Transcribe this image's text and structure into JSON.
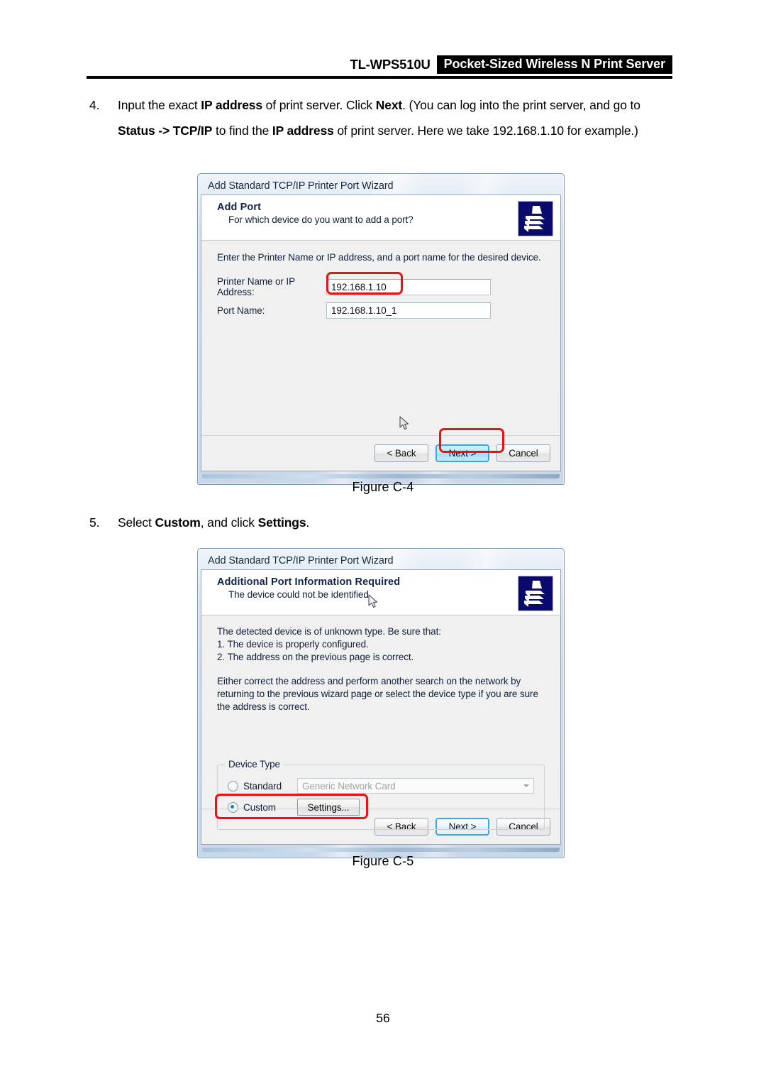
{
  "header": {
    "model": "TL-WPS510U",
    "tagline": "Pocket-Sized Wireless N Print Server"
  },
  "steps": [
    {
      "number": "4.",
      "parts": [
        {
          "text": "Input the exact ",
          "bold": false
        },
        {
          "text": "IP address",
          "bold": true
        },
        {
          "text": " of print server. Click ",
          "bold": false
        },
        {
          "text": "Next",
          "bold": true
        },
        {
          "text": ". (You can log into the print server, and go to ",
          "bold": false
        },
        {
          "text": "Status -> TCP/IP",
          "bold": true
        },
        {
          "text": " to find the ",
          "bold": false
        },
        {
          "text": "IP address",
          "bold": true
        },
        {
          "text": " of print server. Here we take 192.168.1.10 for example.)",
          "bold": false
        }
      ]
    },
    {
      "number": "5.",
      "parts": [
        {
          "text": "Select ",
          "bold": false
        },
        {
          "text": "Custom",
          "bold": true
        },
        {
          "text": ", and click ",
          "bold": false
        },
        {
          "text": "Settings",
          "bold": true
        },
        {
          "text": ".",
          "bold": false
        }
      ]
    }
  ],
  "dialog_add_port": {
    "titlebar": "Add Standard TCP/IP Printer Port Wizard",
    "banner_title": "Add Port",
    "banner_subtitle": "For which device do you want to add a port?",
    "icon": "printer-icon",
    "intro": "Enter the Printer Name or IP address, and a port name for the desired device.",
    "fields": [
      {
        "label": "Printer Name or IP Address:",
        "value": "192.168.1.10",
        "highlighted": true
      },
      {
        "label": "Port Name:",
        "value": "192.168.1.10_1",
        "highlighted": false
      }
    ],
    "buttons": [
      {
        "label": "< Back",
        "state": "normal"
      },
      {
        "label": "Next >",
        "state": "focused-accent"
      },
      {
        "label": "Cancel",
        "state": "normal"
      }
    ],
    "cursor": "mouse-pointer"
  },
  "figure_caption_4": "Figure C-4",
  "dialog_port_info": {
    "titlebar": "Add Standard TCP/IP Printer Port Wizard",
    "banner_title": "Additional Port Information Required",
    "banner_subtitle": "The device could not be identified.",
    "icon": "printer-icon",
    "body_lines": [
      "The detected device is of unknown type.  Be sure that:",
      "1. The device is properly configured.",
      "2.  The address on the previous page is correct."
    ],
    "paragraph": "Either correct the address and perform another search on the network by returning to the previous wizard page or select the device type if you are sure the address is correct.",
    "groupbox": {
      "legend": "Device Type",
      "standard": {
        "label": "Standard",
        "checked": false,
        "combo_value": "Generic Network Card",
        "combo_disabled": true
      },
      "custom": {
        "label": "Custom",
        "checked": true,
        "settings_label": "Settings..."
      }
    },
    "buttons": [
      {
        "label": "< Back",
        "state": "normal"
      },
      {
        "label": "Next >",
        "state": "focused"
      },
      {
        "label": "Cancel",
        "state": "normal"
      }
    ],
    "cursor": "mouse-pointer"
  },
  "figure_caption_5": "Figure C-5",
  "page_number": "56",
  "colors": {
    "annotation_red": "#ee1111",
    "header_black": "#000000",
    "dialog_icon_navy": "#0a0a6e",
    "focus_blue": "#3ca7df"
  }
}
